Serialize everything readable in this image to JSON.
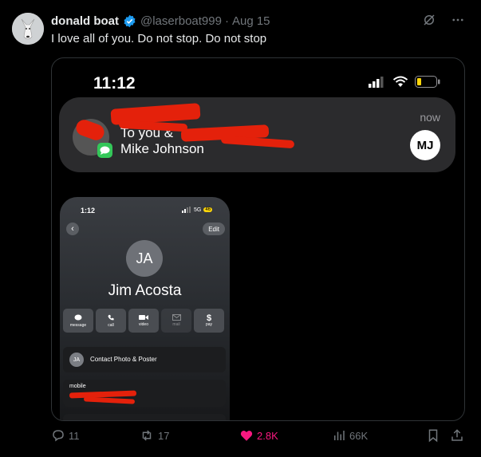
{
  "tweet": {
    "author_name": "donald boat",
    "author_handle": "@laserboat999",
    "separator": "·",
    "date": "Aug 15",
    "text": "I love all of you. Do not stop. Do not stop"
  },
  "media": {
    "status_time": "11:12",
    "notification": {
      "title": "To you &",
      "subtitle": "Mike Johnson",
      "time": "now",
      "avatar_initials": "MJ"
    },
    "phone": {
      "time": "1:12",
      "network": "5G",
      "battery": "46",
      "edit_label": "Edit",
      "avatar_initials": "JA",
      "contact_name": "Jim Acosta",
      "actions": [
        "message",
        "call",
        "video",
        "mail",
        "pay"
      ],
      "contact_photo_label": "Contact Photo & Poster",
      "contact_photo_initials": "JA",
      "mobile_label": "mobile"
    }
  },
  "stats": {
    "replies": "11",
    "reposts": "17",
    "likes": "2.8K",
    "views": "66K"
  },
  "colors": {
    "accent_blue": "#1d9bf0",
    "like_pink": "#f91880",
    "redaction_red": "#e4210b"
  }
}
